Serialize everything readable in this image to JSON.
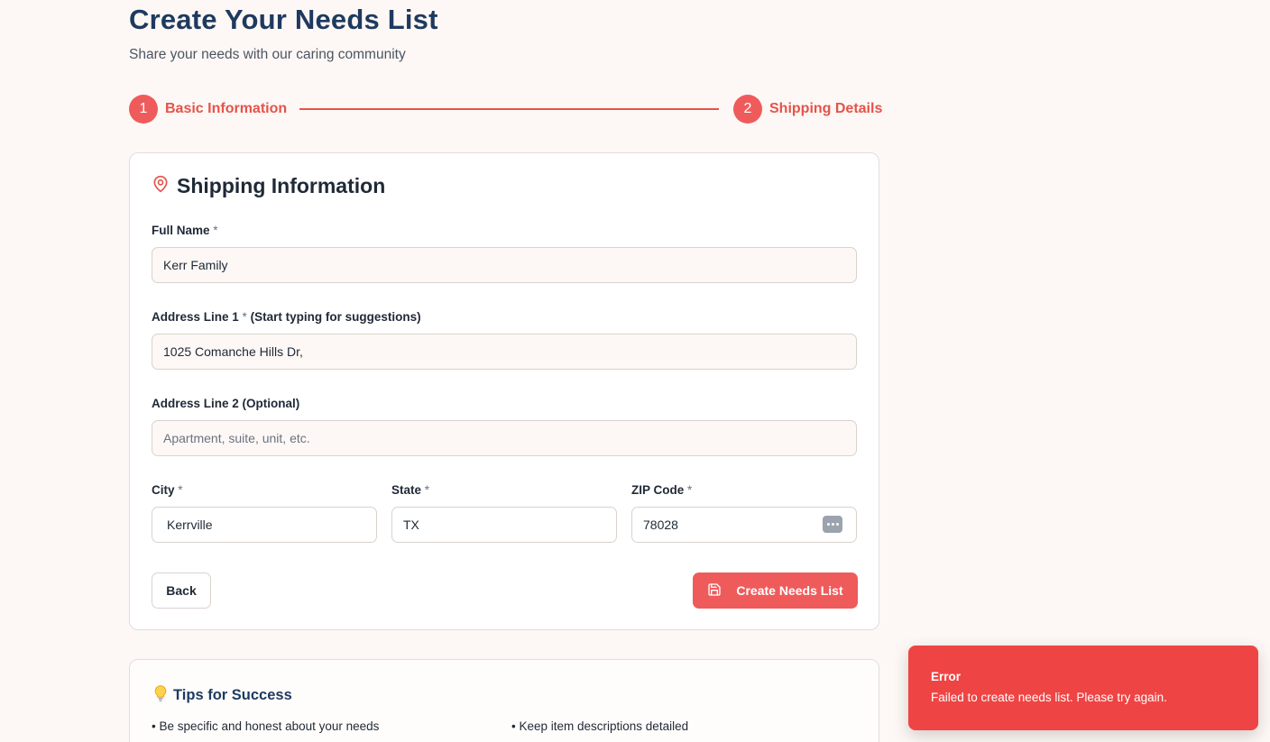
{
  "header": {
    "title": "Create Your Needs List",
    "subtitle": "Share your needs with our caring community"
  },
  "stepper": {
    "steps": [
      {
        "number": "1",
        "label": "Basic Information"
      },
      {
        "number": "2",
        "label": "Shipping Details"
      }
    ]
  },
  "shipping": {
    "title": "Shipping Information",
    "icon": "map-pin-icon",
    "full_name": {
      "label": "Full Name",
      "required": "*",
      "value": "Kerr Family"
    },
    "address1": {
      "label": "Address Line 1",
      "required": "*",
      "hint": "(Start typing for suggestions)",
      "value": "1025 Comanche Hills Dr,"
    },
    "address2": {
      "label": "Address Line 2 (Optional)",
      "placeholder": "Apartment, suite, unit, etc.",
      "value": ""
    },
    "city": {
      "label": "City",
      "required": "*",
      "value": "Kerrville"
    },
    "state": {
      "label": "State",
      "required": "*",
      "value": "TX"
    },
    "zip": {
      "label": "ZIP Code",
      "required": "*",
      "value": "78028"
    },
    "back_label": "Back",
    "create_label": "Create Needs List"
  },
  "tips": {
    "icon": "lightbulb-icon",
    "title": "Tips for Success",
    "items": [
      "• Be specific and honest about your needs",
      "• Keep item descriptions detailed"
    ]
  },
  "toast": {
    "title": "Error",
    "message": "Failed to create needs list. Please try again."
  },
  "colors": {
    "accent": "#ef5b5b",
    "heading": "#1e3a5f",
    "error": "#ef4444",
    "background": "#fdf8f5"
  }
}
